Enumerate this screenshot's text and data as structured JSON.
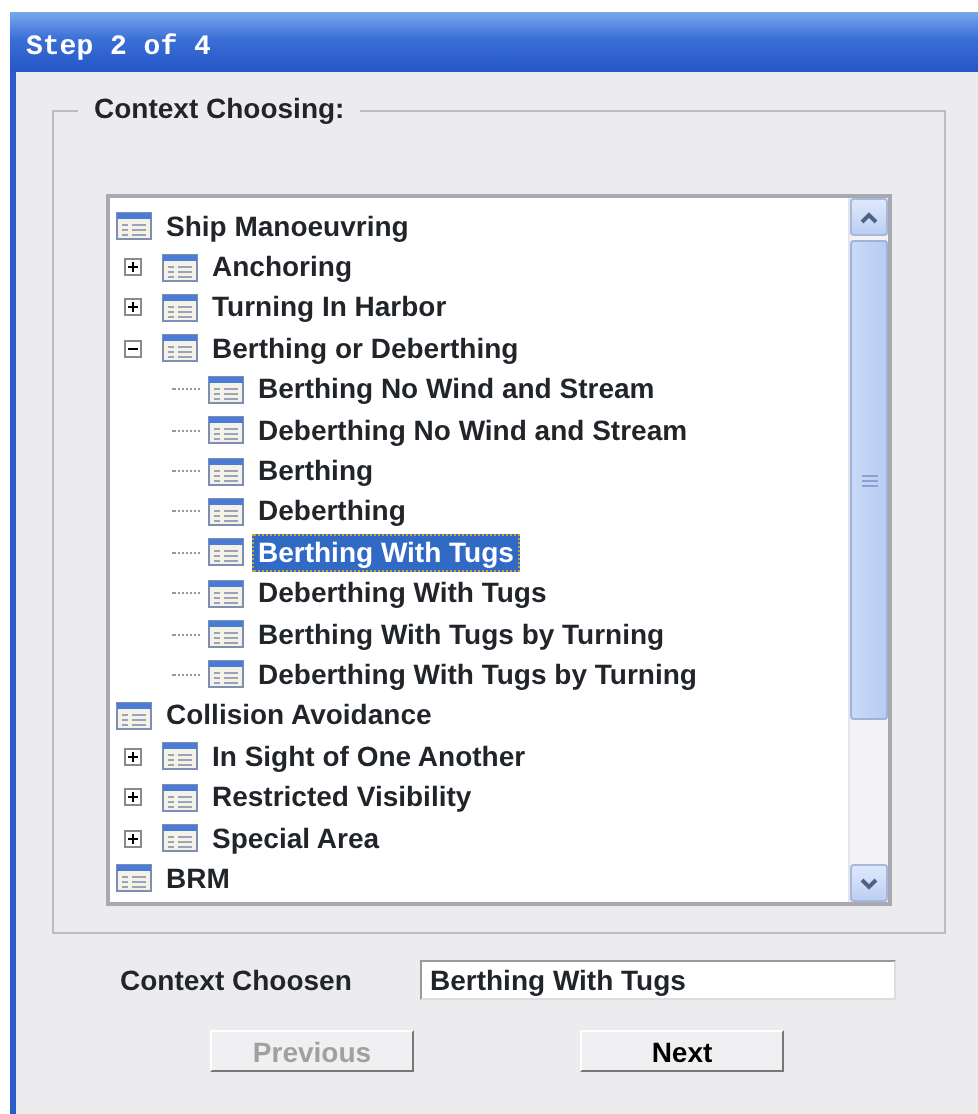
{
  "window": {
    "title": "Step 2 of 4"
  },
  "group": {
    "legend": "Context Choosing:"
  },
  "tree": {
    "nodes": [
      {
        "label": "Ship Manoeuvring",
        "selected": false,
        "expanded": true,
        "children": [
          {
            "label": "Anchoring",
            "selected": false,
            "expanded": false
          },
          {
            "label": "Turning In Harbor",
            "selected": false,
            "expanded": false
          },
          {
            "label": "Berthing or Deberthing",
            "selected": false,
            "expanded": true,
            "children": [
              {
                "label": "Berthing No Wind and Stream",
                "selected": false
              },
              {
                "label": "Deberthing No Wind and Stream",
                "selected": false
              },
              {
                "label": "Berthing",
                "selected": false
              },
              {
                "label": "Deberthing",
                "selected": false
              },
              {
                "label": "Berthing With Tugs",
                "selected": true
              },
              {
                "label": "Deberthing With Tugs",
                "selected": false
              },
              {
                "label": "Berthing With Tugs by Turning",
                "selected": false
              },
              {
                "label": "Deberthing With Tugs by Turning",
                "selected": false
              }
            ]
          }
        ]
      },
      {
        "label": "Collision Avoidance",
        "selected": false,
        "expanded": true,
        "children": [
          {
            "label": "In Sight of One Another",
            "selected": false,
            "expanded": false
          },
          {
            "label": "Restricted Visibility",
            "selected": false,
            "expanded": false
          },
          {
            "label": "Special Area",
            "selected": false,
            "expanded": false
          }
        ]
      },
      {
        "label": "BRM",
        "selected": false,
        "expanded": true
      }
    ]
  },
  "context_choosen": {
    "label": "Context Choosen",
    "value": "Berthing With Tugs"
  },
  "buttons": [
    {
      "label": "Previous",
      "disabled": true
    },
    {
      "label": "Next",
      "disabled": false
    }
  ]
}
